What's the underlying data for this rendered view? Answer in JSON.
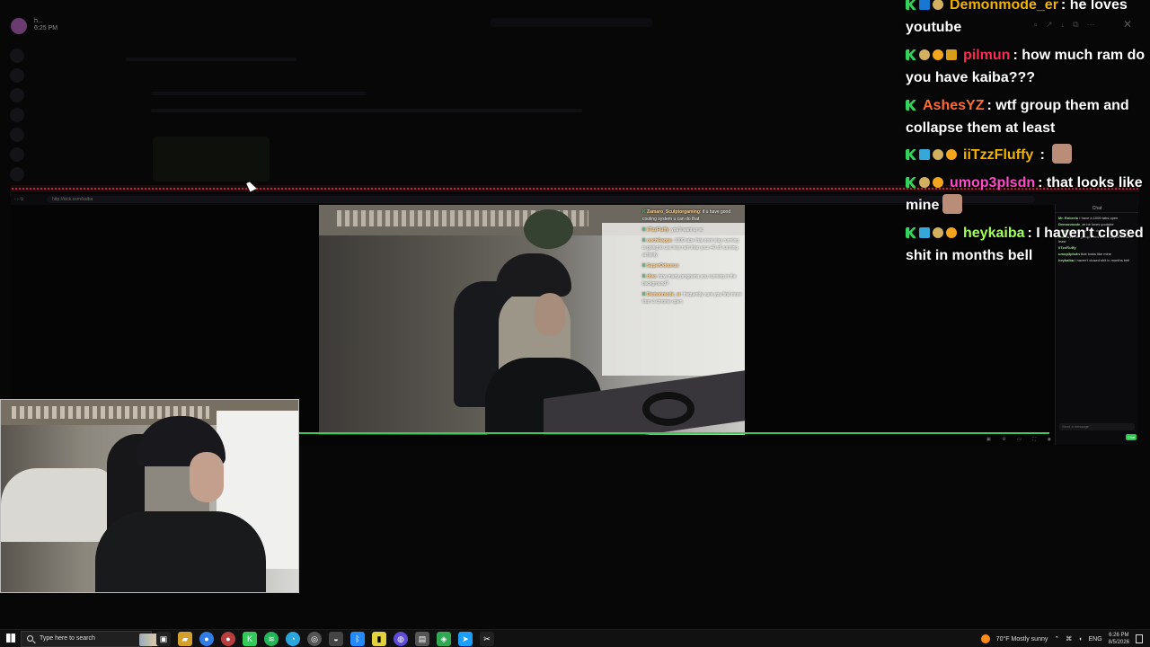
{
  "background": {
    "user": {
      "name": "h...",
      "time": "6:25 PM"
    }
  },
  "browser": {
    "url": "http://kick.com/kaiba"
  },
  "stream_overlay_chat": [
    {
      "user": "Zamaro_Sculptorgaming",
      "text": "if u have good cooling system u can do that"
    },
    {
      "user": "iiTzzFluffy",
      "text": "you'll want ur vc"
    },
    {
      "user": "oochikappa",
      "text": "1000 tabs that dont stay running is going to use less ram than your 40 sfl running actively"
    },
    {
      "user": "SuperOdourus",
      "text": ""
    },
    {
      "user": "divo",
      "text": "how many programs you running in the background?"
    },
    {
      "user": "Demonmode_er",
      "text": "frequently sure you find more than 3 chrome open"
    }
  ],
  "mini_chat": {
    "header": "Chat",
    "input_placeholder": "Send a message",
    "send_label": "Chat",
    "lines": [
      {
        "user": "Mr. Roberto",
        "text": "I have a 1000 tabs open"
      },
      {
        "user": "Demonmode_er",
        "text": "he loves youtube"
      },
      {
        "user": "pilmun",
        "text": "how much ram do you have kaiba???"
      },
      {
        "user": "AshesYZ",
        "text": "wtf group them and collapse them at least"
      },
      {
        "user": "iiTzzFluffy",
        "text": ""
      },
      {
        "user": "umop3plsdn",
        "text": "that looks like mine"
      },
      {
        "user": "heykaiba",
        "text": "I haven't closed shit in months bell"
      }
    ]
  },
  "chat_overlay": [
    {
      "user": "Demonmode_er",
      "message": "he loves youtube",
      "user_color": "#f2b300",
      "badges": [
        "green",
        "blue",
        "gold"
      ]
    },
    {
      "user": "pilmun",
      "message": "how much ram do you have kaiba???",
      "user_color": "#ff2a4f",
      "badges": [
        "green",
        "gold",
        "orange",
        "chest"
      ]
    },
    {
      "user": "AshesYZ",
      "message": "wtf group them and collapse them at least",
      "user_color": "#ff6b32",
      "badges": [
        "green"
      ]
    },
    {
      "user": "iiTzzFluffy",
      "message": "",
      "user_color": "#f2b300",
      "badges": [
        "green",
        "teal",
        "gold",
        "orange"
      ]
    },
    {
      "user": "umop3plsdn",
      "message": "that looks like mine",
      "user_color": "#ff49c8",
      "badges": [
        "green",
        "gold",
        "orange"
      ]
    },
    {
      "user": "heykaiba",
      "message": "I haven't closed shit in months bell",
      "user_color": "#a1ff55",
      "badges": [
        "green",
        "teal",
        "gold",
        "orange"
      ]
    }
  ],
  "taskbar": {
    "search_placeholder": "Type here to search",
    "weather": "70°F  Mostly sunny",
    "language": "ENG",
    "time": "6:26 PM",
    "date": "8/5/2026"
  },
  "colors": {
    "accent_green": "#43c655",
    "kick_green": "#31d35a"
  }
}
